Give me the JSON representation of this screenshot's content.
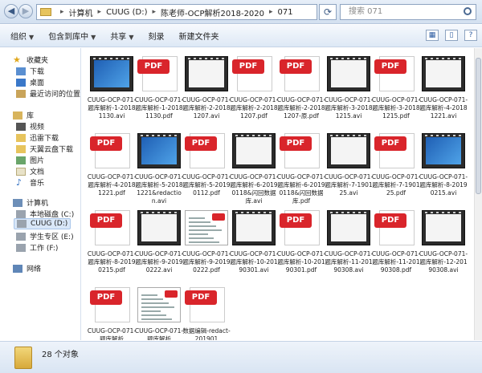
{
  "address": {
    "crumbs": [
      "计算机",
      "CUUG (D:)",
      "陈老师-OCP解析2018-2020",
      "071"
    ],
    "search_placeholder": "搜索 071"
  },
  "toolbar": {
    "organize": "组织",
    "include": "包含到库中",
    "share": "共享",
    "burn": "刻录",
    "new_folder": "新建文件夹"
  },
  "sidebar": {
    "favorites": "收藏夹",
    "downloads": "下载",
    "desktop": "桌面",
    "recent": "最近访问的位置",
    "libraries": "库",
    "videos": "视频",
    "xunlei": "迅雷下载",
    "tianyi": "天翼云盘下载",
    "pictures": "图片",
    "documents": "文档",
    "music": "音乐",
    "computer": "计算机",
    "local_c": "本地磁盘 (C:)",
    "cuug_d": "CUUG (D:)",
    "student_e": "学生专区 (E:)",
    "work_f": "工作 (F:)",
    "network": "网络"
  },
  "files": [
    {
      "name": "CUUG-OCP-071-题库解析-1-20181130.avi",
      "type": "video-desktop"
    },
    {
      "name": "CUUG-OCP-071-题库解析-1-20181130.pdf",
      "type": "pdf"
    },
    {
      "name": "CUUG-OCP-071-题库解析-2-20181207.avi",
      "type": "video"
    },
    {
      "name": "CUUG-OCP-071-题库解析-2-20181207.pdf",
      "type": "pdf"
    },
    {
      "name": "CUUG-OCP-071-题库解析-2-20181207-原.pdf",
      "type": "pdf"
    },
    {
      "name": "CUUG-OCP-071-题库解析-3-20181215.avi",
      "type": "video"
    },
    {
      "name": "CUUG-OCP-071-题库解析-3-20181215.pdf",
      "type": "pdf"
    },
    {
      "name": "CUUG-OCP-071-题库解析-4-20181221.avi",
      "type": "video"
    },
    {
      "name": "CUUG-OCP-071-题库解析-4-20181221.pdf",
      "type": "pdf"
    },
    {
      "name": "CUUG-OCP-071-题库解析-5-20181221&redaction.avi",
      "type": "video-desktop"
    },
    {
      "name": "CUUG-OCP-071-题库解析-5-20190112.pdf",
      "type": "pdf"
    },
    {
      "name": "CUUG-OCP-071-题库解析-6-20190118&闪回数据库.avi",
      "type": "video"
    },
    {
      "name": "CUUG-OCP-071-题库解析-6-20190118&闪回数据库.pdf",
      "type": "pdf"
    },
    {
      "name": "CUUG-OCP-071-题库解析-7-190125.avi",
      "type": "video"
    },
    {
      "name": "CUUG-OCP-071-题库解析-7-190125.pdf",
      "type": "pdf"
    },
    {
      "name": "CUUG-OCP-071-题库解析-8-20190215.avi",
      "type": "video-desktop"
    },
    {
      "name": "CUUG-OCP-071-题库解析-8-20190215.pdf",
      "type": "pdf"
    },
    {
      "name": "CUUG-OCP-071-题库解析-9-20190222.avi",
      "type": "video"
    },
    {
      "name": "CUUG-OCP-071-题库解析-9-20190222.pdf",
      "type": "pdf-shot"
    },
    {
      "name": "CUUG-OCP-071-题库解析-10-20190301.avi",
      "type": "video"
    },
    {
      "name": "CUUG-OCP-071-题库解析-10-20190301.pdf",
      "type": "pdf"
    },
    {
      "name": "CUUG-OCP-071-题库解析-11-20190308.avi",
      "type": "video"
    },
    {
      "name": "CUUG-OCP-071-题库解析-11-20190308.pdf",
      "type": "pdf"
    },
    {
      "name": "CUUG-OCP-071-题库解析-12-20190308.avi",
      "type": "video"
    },
    {
      "name": "CUUG-OCP-071-题库解析",
      "type": "pdf"
    },
    {
      "name": "CUUG-OCP-071-题库解析",
      "type": "pdf-shot"
    },
    {
      "name": "数据编辑-redact-201901",
      "type": "pdf"
    },
    {
      "name": "",
      "type": "none"
    }
  ],
  "status": {
    "count_text": "28 个对象"
  },
  "colors": {
    "pdf_red": "#d9252b",
    "selection": "#d9e7f8",
    "chrome": "#dde8f5"
  }
}
